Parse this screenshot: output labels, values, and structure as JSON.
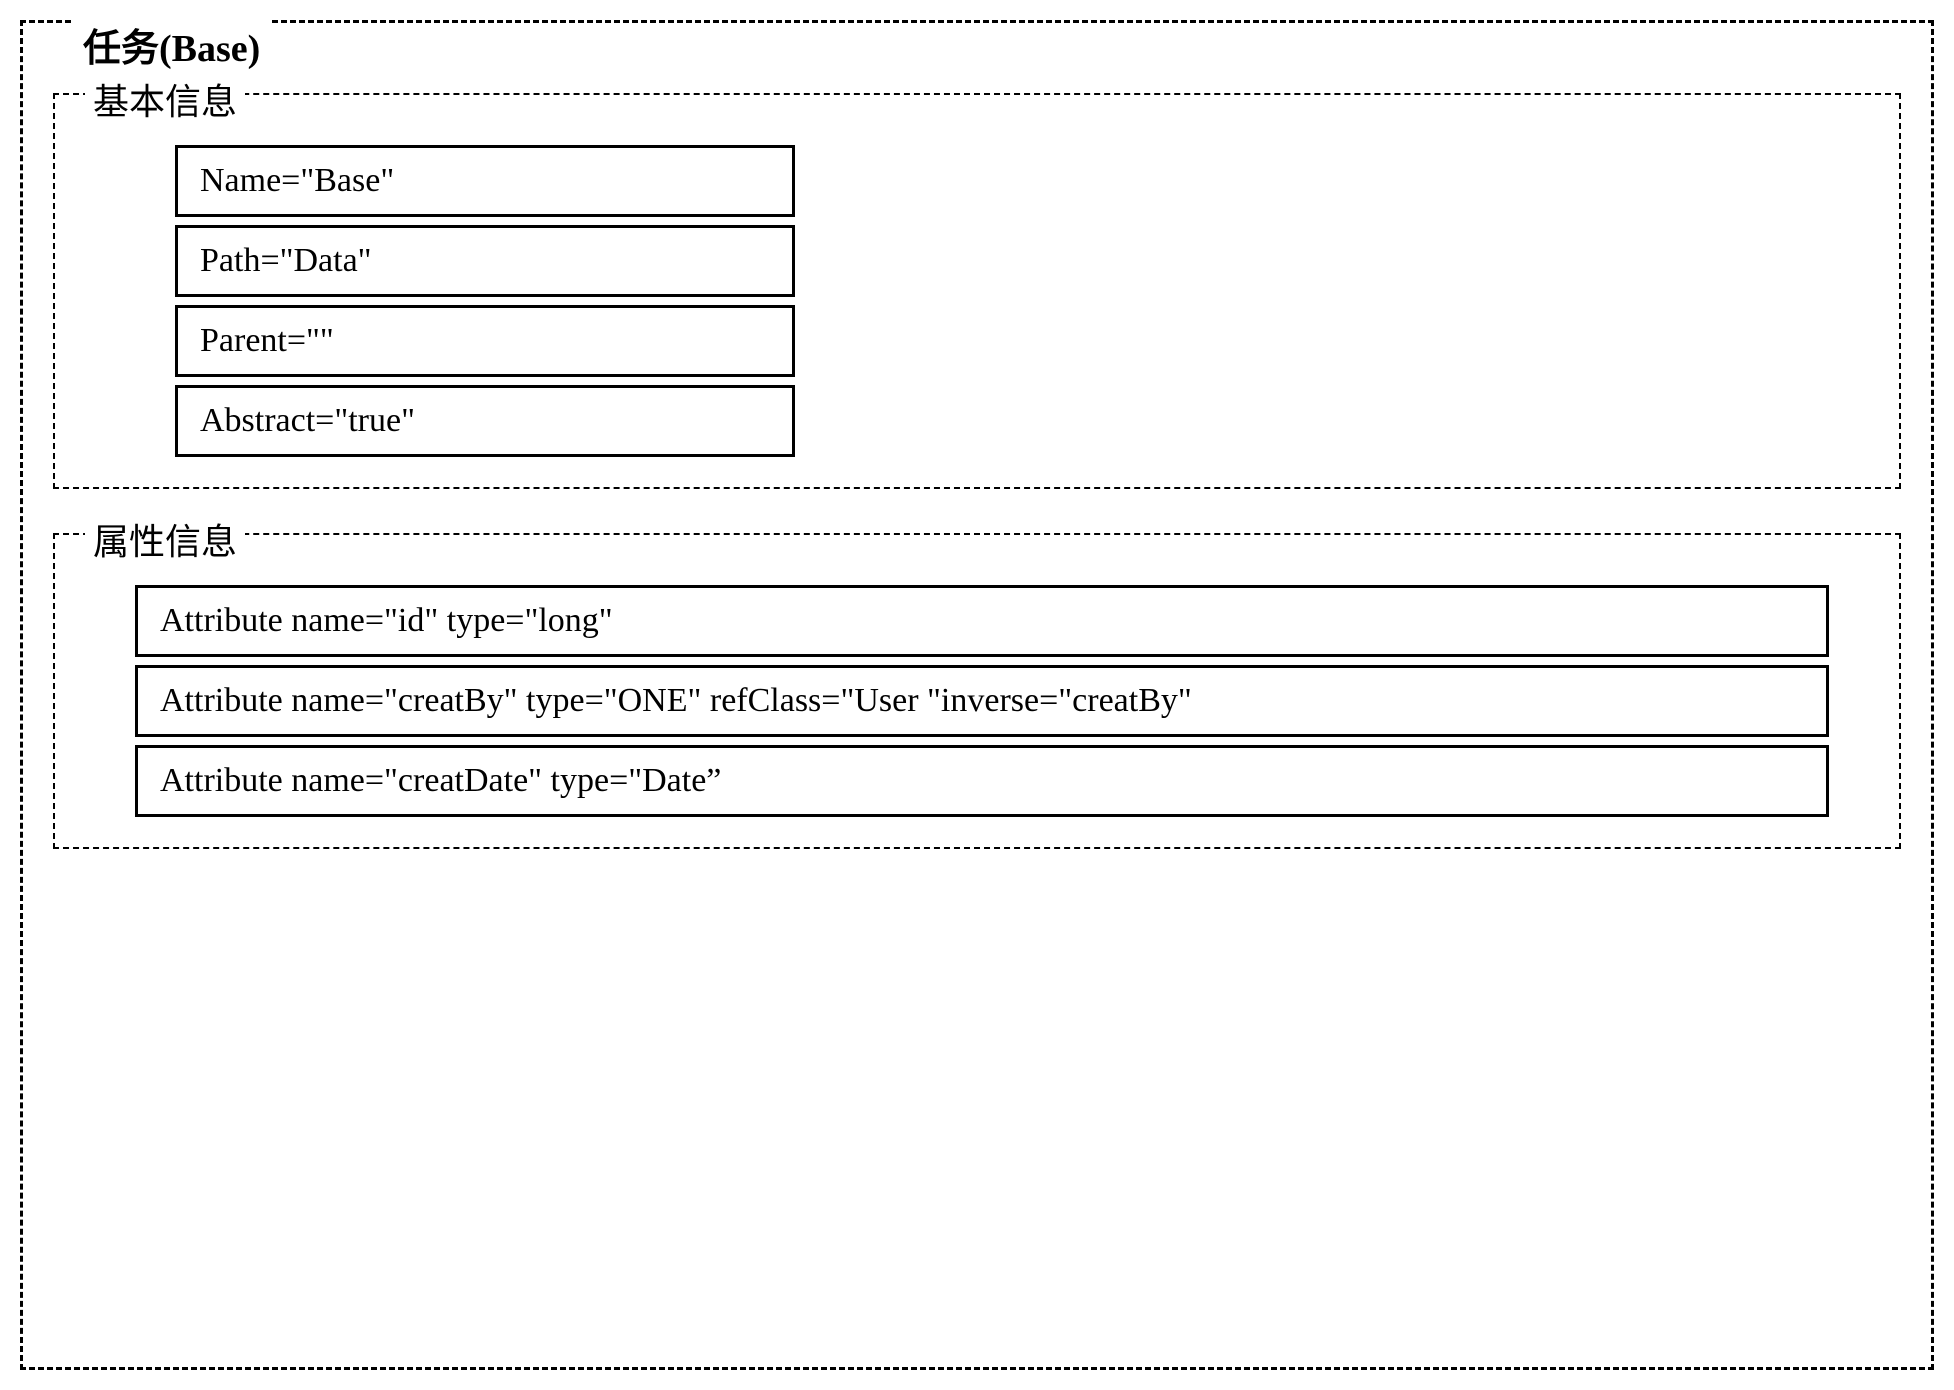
{
  "outer": {
    "title": "任务(Base)"
  },
  "basic": {
    "title": "基本信息",
    "rows": {
      "name": "Name=\"Base\"",
      "path": "Path=\"Data\"",
      "parent": "Parent=\"\"",
      "abstract": "Abstract=\"true\""
    }
  },
  "attrs": {
    "title": "属性信息",
    "rows": {
      "r0": "Attribute name=\"id\" type=\"long\"",
      "r1": "Attribute name=\"creatBy\"  type=\"ONE\" refClass=\"User \"inverse=\"creatBy\"",
      "r2": "Attribute name=\"creatDate\"  type=\"Date”"
    }
  }
}
